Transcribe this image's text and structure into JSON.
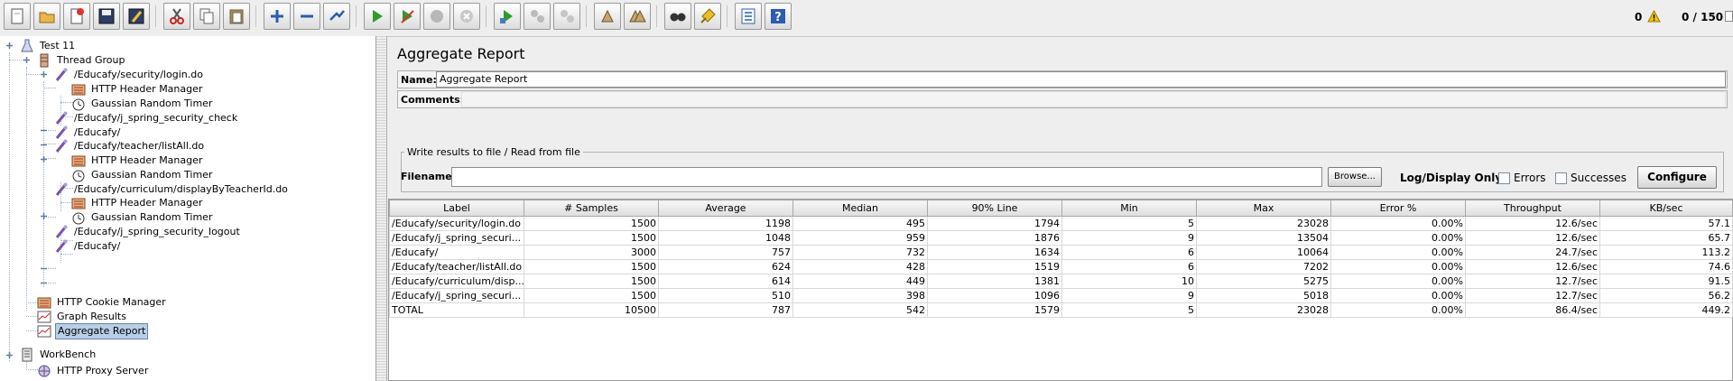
{
  "toolbar": {
    "buttons": [
      "new-icon",
      "open-icon",
      "close-icon",
      "save-icon",
      "save-as-icon",
      "cut-icon",
      "copy-icon",
      "paste-icon",
      "expand-icon",
      "collapse-icon",
      "toggle-icon",
      "start-icon",
      "start-no-pauses-icon",
      "stop-icon",
      "shutdown-icon",
      "remote-start-icon",
      "remote-stop-icon",
      "remote-shutdown-icon",
      "clear-icon",
      "clear-all-icon",
      "search-icon",
      "reset-search-icon",
      "function-helper-icon",
      "help-icon"
    ],
    "warning_count": "0",
    "threads": "0 / 150"
  },
  "tree": {
    "nodes": [
      {
        "label": "Test 11",
        "icon": "test-plan-icon"
      },
      {
        "label": "Thread Group",
        "icon": "thread-group-icon"
      },
      {
        "label": "/Educafy/security/login.do",
        "icon": "sampler-icon"
      },
      {
        "label": "HTTP Header Manager",
        "icon": "header-manager-icon"
      },
      {
        "label": "Gaussian Random Timer",
        "icon": "timer-icon"
      },
      {
        "label": "/Educafy/j_spring_security_check",
        "icon": "sampler-icon"
      },
      {
        "label": "/Educafy/",
        "icon": "sampler-icon"
      },
      {
        "label": "/Educafy/teacher/listAll.do",
        "icon": "sampler-icon"
      },
      {
        "label": "HTTP Header Manager",
        "icon": "header-manager-icon"
      },
      {
        "label": "Gaussian Random Timer",
        "icon": "timer-icon"
      },
      {
        "label": "/Educafy/curriculum/displayByTeacherId.do",
        "icon": "sampler-icon"
      },
      {
        "label": "HTTP Header Manager",
        "icon": "header-manager-icon"
      },
      {
        "label": "Gaussian Random Timer",
        "icon": "timer-icon"
      },
      {
        "label": "/Educafy/j_spring_security_logout",
        "icon": "sampler-icon"
      },
      {
        "label": "/Educafy/",
        "icon": "sampler-icon"
      },
      {
        "label": "HTTP Cookie Manager",
        "icon": "cookie-manager-icon"
      },
      {
        "label": "Graph Results",
        "icon": "graph-icon"
      },
      {
        "label": "Aggregate Report",
        "icon": "report-icon"
      },
      {
        "label": "WorkBench",
        "icon": "workbench-icon"
      },
      {
        "label": "HTTP Proxy Server",
        "icon": "proxy-icon"
      }
    ]
  },
  "panel": {
    "title": "Aggregate Report",
    "name_label": "Name:",
    "name_value": "Aggregate Report",
    "comments_label": "Comments:",
    "comments_value": "",
    "write_legend": "Write results to file / Read from file",
    "filename_label": "Filename",
    "filename_value": "",
    "browse_label": "Browse...",
    "log_display_label": "Log/Display Only:",
    "errors_label": "Errors",
    "successes_label": "Successes",
    "configure_label": "Configure"
  },
  "table": {
    "headers": [
      "Label",
      "# Samples",
      "Average",
      "Median",
      "90% Line",
      "Min",
      "Max",
      "Error %",
      "Throughput",
      "KB/sec"
    ],
    "rows": [
      [
        "/Educafy/security/login.do",
        "1500",
        "1198",
        "495",
        "1794",
        "5",
        "23028",
        "0.00%",
        "12.6/sec",
        "57.1"
      ],
      [
        "/Educafy/j_spring_securi...",
        "1500",
        "1048",
        "959",
        "1876",
        "9",
        "13504",
        "0.00%",
        "12.6/sec",
        "65.7"
      ],
      [
        "/Educafy/",
        "3000",
        "757",
        "732",
        "1634",
        "6",
        "10064",
        "0.00%",
        "24.7/sec",
        "113.2"
      ],
      [
        "/Educafy/teacher/listAll.do",
        "1500",
        "624",
        "428",
        "1519",
        "6",
        "7202",
        "0.00%",
        "12.6/sec",
        "74.6"
      ],
      [
        "/Educafy/curriculum/disp...",
        "1500",
        "614",
        "449",
        "1381",
        "10",
        "5275",
        "0.00%",
        "12.7/sec",
        "91.5"
      ],
      [
        "/Educafy/j_spring_securi...",
        "1500",
        "510",
        "398",
        "1096",
        "9",
        "5018",
        "0.00%",
        "12.7/sec",
        "56.2"
      ],
      [
        "TOTAL",
        "10500",
        "787",
        "542",
        "1579",
        "5",
        "23028",
        "0.00%",
        "86.4/sec",
        "449.2"
      ]
    ]
  },
  "colors": {
    "selection": "#b8cfe5",
    "background": "#eeeeee",
    "toolbar_green": "#2e9b2e",
    "warning": "#f5c400"
  }
}
